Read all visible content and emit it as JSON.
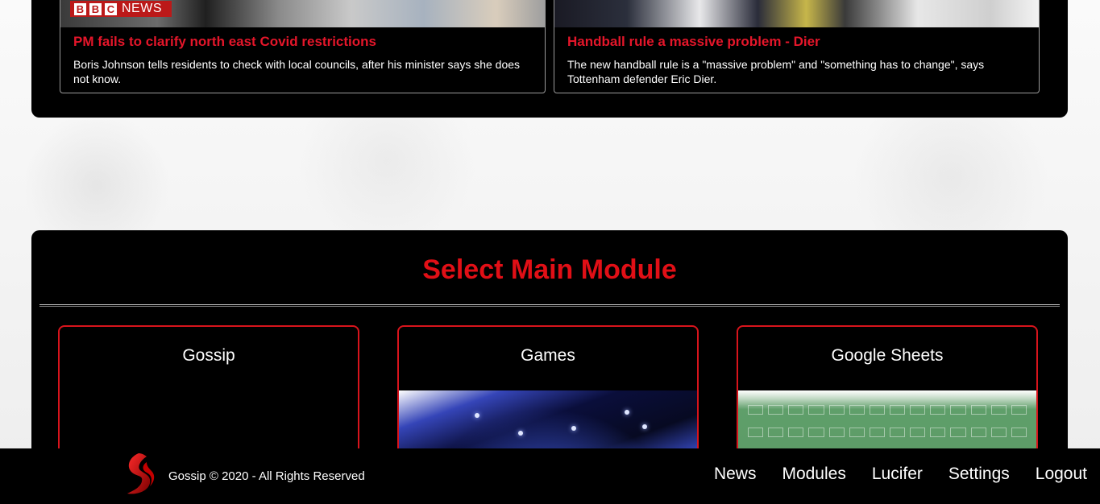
{
  "news": {
    "items": [
      {
        "title": "PM fails to clarify north east Covid restrictions",
        "description": "Boris Johnson tells residents to check with local councils, after his minister says she does not know.",
        "source_badge": {
          "box_letters": [
            "B",
            "B",
            "C"
          ],
          "word": "NEWS"
        }
      },
      {
        "title": "Handball rule a massive problem - Dier",
        "description": "The new handball rule is a \"massive problem\" and \"something has to change\", says Tottenham defender Eric Dier."
      }
    ]
  },
  "modules": {
    "heading": "Select Main Module",
    "cards": [
      {
        "title": "Gossip"
      },
      {
        "title": "Games"
      },
      {
        "title": "Google Sheets"
      }
    ]
  },
  "footer": {
    "copyright": "Gossip © 2020 - All Rights Reserved",
    "nav": [
      "News",
      "Modules",
      "Lucifer",
      "Settings",
      "Logout"
    ]
  },
  "colors": {
    "accent": "#e10f16",
    "panel": "#000000",
    "text": "#ffffff"
  }
}
